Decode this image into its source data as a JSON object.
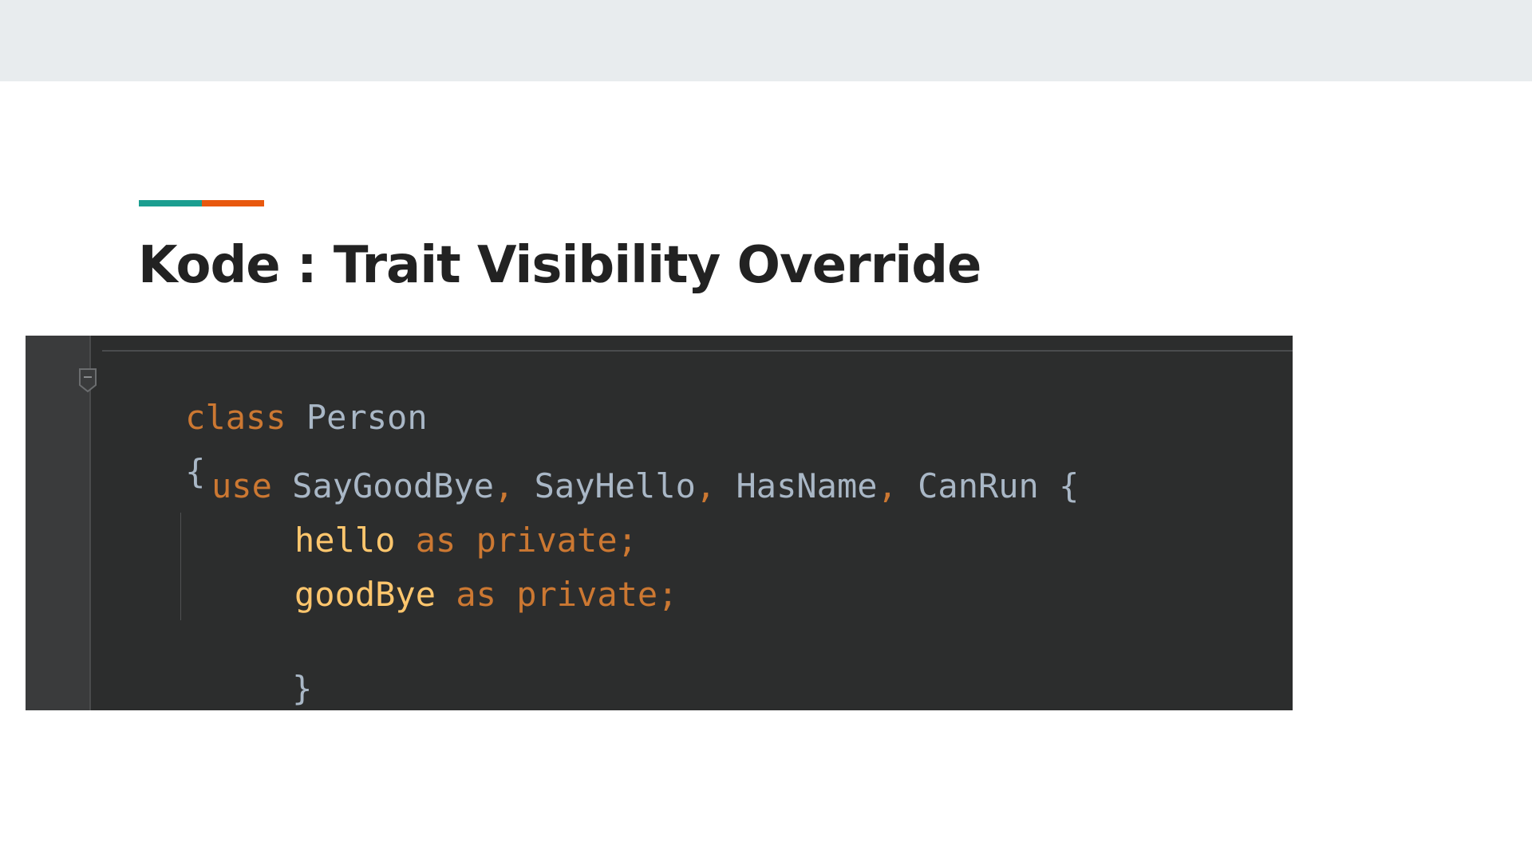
{
  "slide": {
    "title": "Kode : Trait Visibility Override",
    "accent_colors": [
      "#1b9e90",
      "#e8580e"
    ]
  },
  "code": {
    "line1": {
      "keyword": "class",
      "name": "Person"
    },
    "line2": {
      "brace": "{"
    },
    "line3": {
      "keyword": "use",
      "traits": [
        "SayGoodBye",
        "SayHello",
        "HasName",
        "CanRun"
      ],
      "separator": ",",
      "brace": "{"
    },
    "line4": {
      "method": "hello",
      "as": "as",
      "visibility": "private",
      "end": ";"
    },
    "line5": {
      "method": "goodBye",
      "as": "as",
      "visibility": "private",
      "end": ";"
    },
    "line6": {
      "brace": "}"
    }
  },
  "colors": {
    "keyword": "#cc7832",
    "method": "#ffc66d",
    "identifier": "#a9b7c6",
    "editor_bg": "#2c2d2d"
  },
  "icons": {
    "fold": "fold-collapse-icon"
  }
}
